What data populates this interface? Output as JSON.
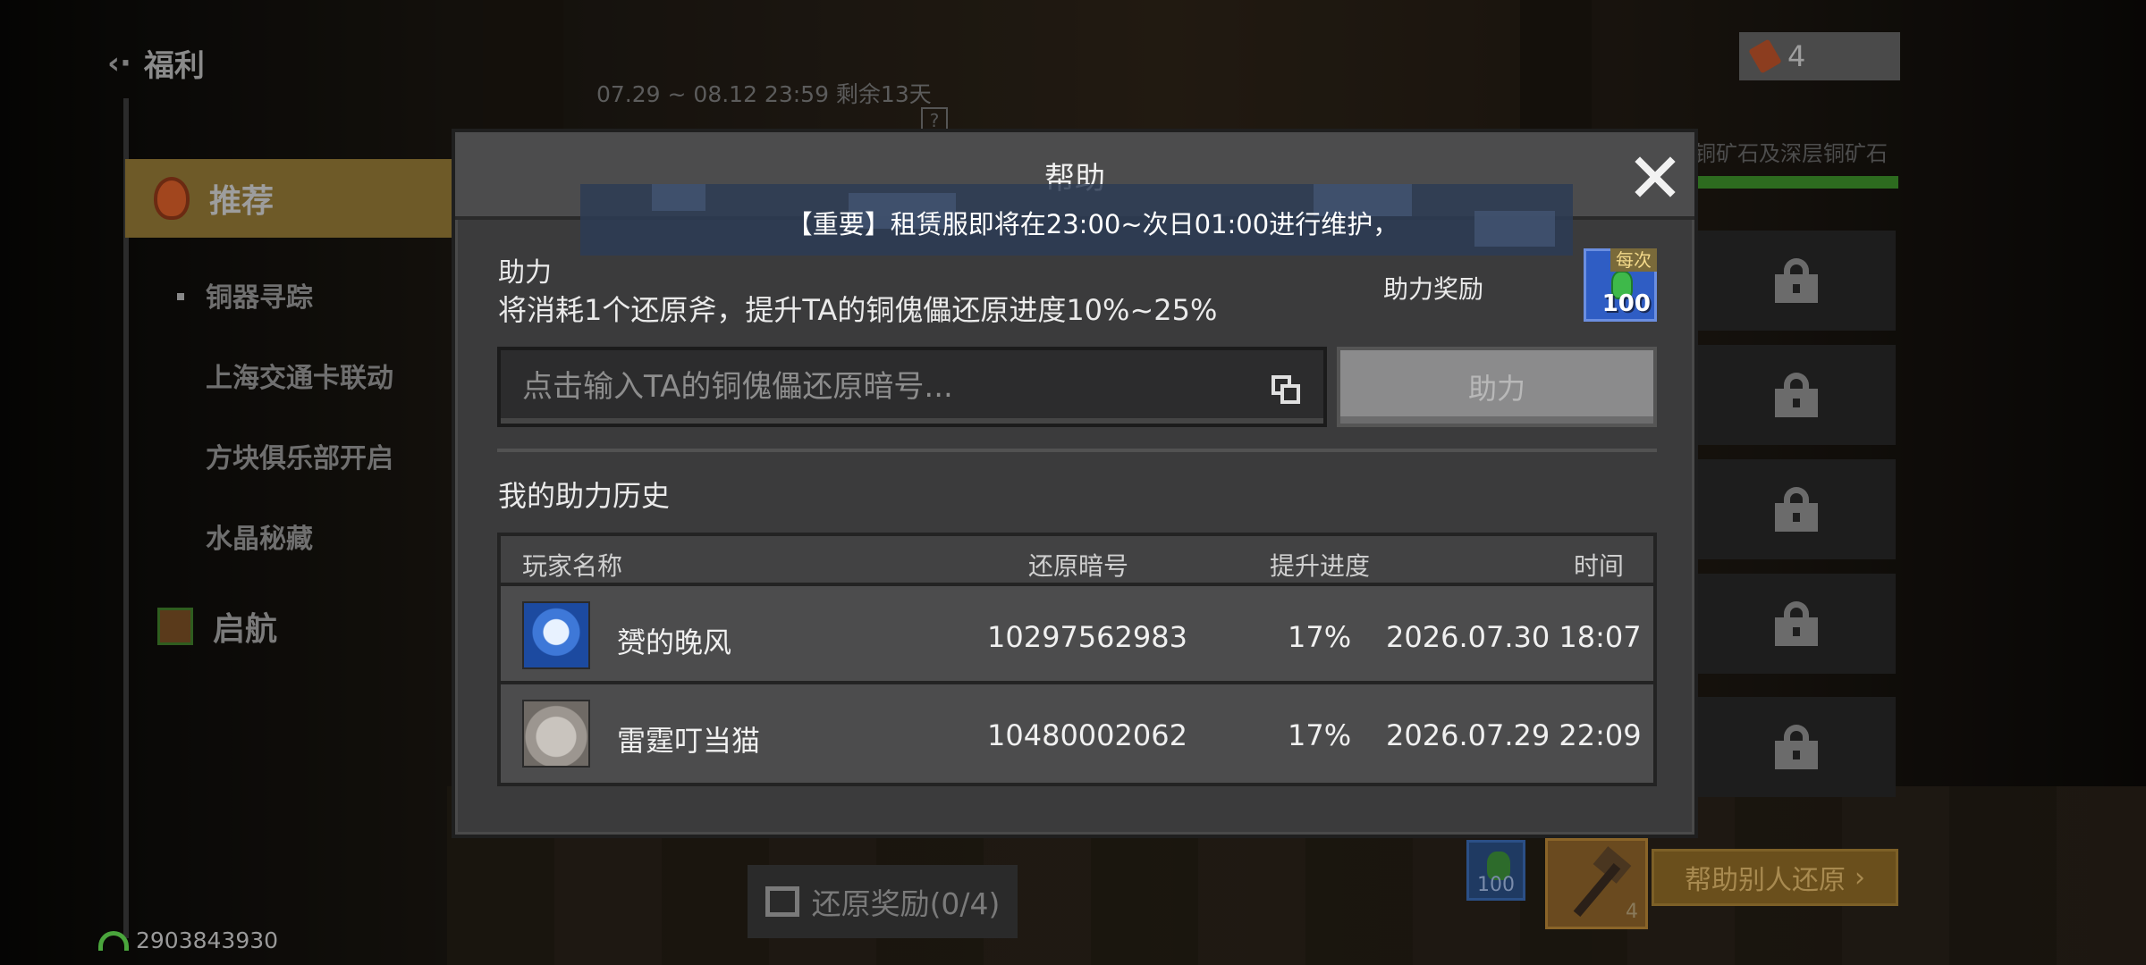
{
  "nav": {
    "back_label": "福利",
    "items": [
      {
        "label": "推荐"
      },
      {
        "label": "铜器寻踪"
      },
      {
        "label": "上海交通卡联动"
      },
      {
        "label": "方块俱乐部开启"
      },
      {
        "label": "水晶秘藏"
      },
      {
        "label": "启航"
      }
    ]
  },
  "status": {
    "user_id": "2903843930"
  },
  "event": {
    "date_range": "07.29 ~ 08.12 23:59 剩余13天",
    "help_icon": "?"
  },
  "top_right": {
    "axe_count": "4",
    "ore_text": "铜矿石及深层铜矿石"
  },
  "bottom": {
    "reward_gem_count": "100",
    "axe_count": "4",
    "help_others_label": "帮助别人还原",
    "restore_reward_label": "还原奖励(0/4)"
  },
  "modal": {
    "title": "帮助",
    "notice": "【重要】租赁服即将在23:00~次日01:00进行维护，",
    "assist_heading": "助力",
    "assist_desc": "将消耗1个还原斧，提升TA的铜傀儡还原进度10%~25%",
    "reward_label": "助力奖励",
    "reward_tag": "每次",
    "reward_amount": "100",
    "input_placeholder": "点击输入TA的铜傀儡还原暗号...",
    "assist_button": "助力",
    "history_title": "我的助力历史",
    "columns": [
      "玩家名称",
      "还原暗号",
      "提升进度",
      "时间"
    ],
    "rows": [
      {
        "name": "赟的晚风",
        "code": "10297562983",
        "progress": "17%",
        "time": "2026.07.30 18:07"
      },
      {
        "name": "雷霆叮当猫",
        "code": "10480002062",
        "progress": "17%",
        "time": "2026.07.29 22:09"
      }
    ]
  },
  "colors": {
    "modal_bg": "#3b3b3c",
    "header_bg": "#4c4c4d",
    "button_disabled": "#8b8b8c",
    "reward_blue": "#2f5dc4",
    "gold": "#6e5a28"
  }
}
